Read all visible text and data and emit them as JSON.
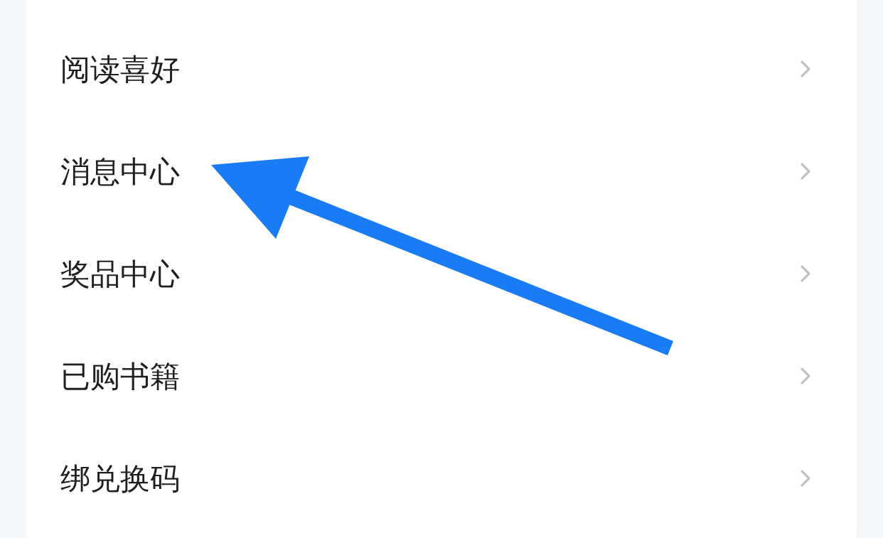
{
  "menu": {
    "items": [
      {
        "label": "阅读喜好"
      },
      {
        "label": "消息中心"
      },
      {
        "label": "奖品中心"
      },
      {
        "label": "已购书籍"
      },
      {
        "label": "绑兑换码"
      }
    ]
  }
}
